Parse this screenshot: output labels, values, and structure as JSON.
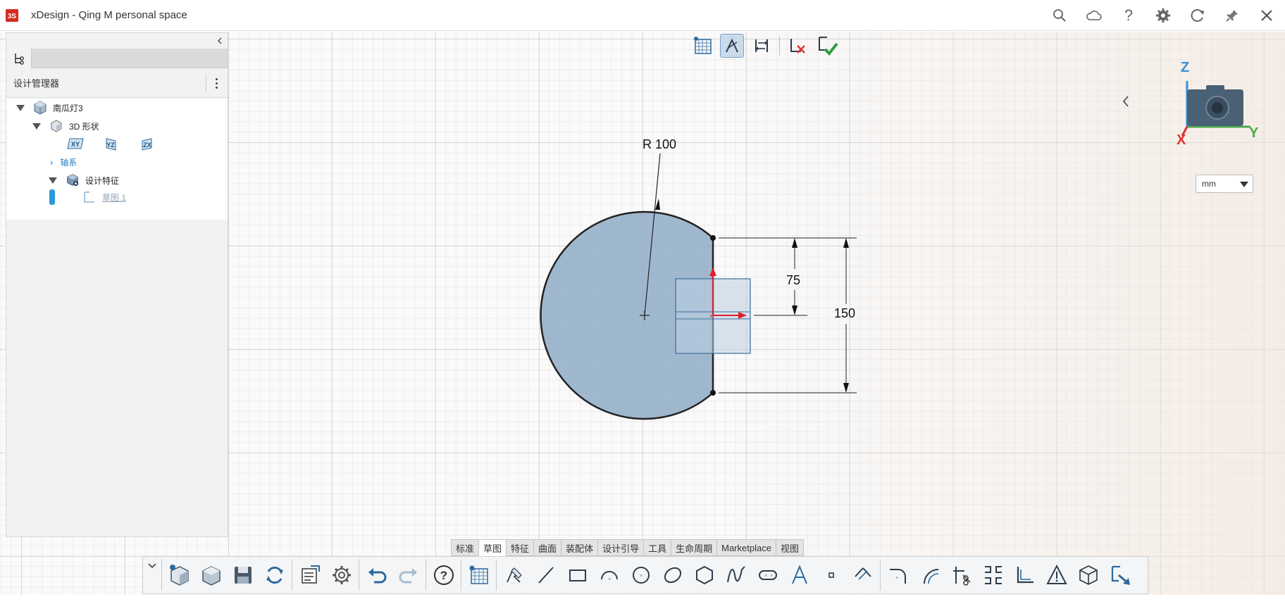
{
  "window": {
    "title": "xDesign - Qing M personal space",
    "logo": "3ds-logo-icon"
  },
  "titlebar_icons": [
    "search-icon",
    "cloud-icon",
    "help-icon",
    "settings-icon",
    "refresh-icon",
    "pin-icon",
    "close-icon"
  ],
  "panel": {
    "header": "设计管理器",
    "tree": {
      "root": "南瓜灯3",
      "shapes": "3D 形状",
      "planes": [
        "XY",
        "YZ",
        "ZX"
      ],
      "axes": "轴系",
      "features": "设计特征",
      "sketch": "草图.1"
    }
  },
  "sketch": {
    "radius_label": "R 100",
    "dim_small": "75",
    "dim_large": "150"
  },
  "view": {
    "axes": {
      "x": "X",
      "y": "Y",
      "z": "Z"
    },
    "unit": "mm"
  },
  "bottom_tabs": [
    "标准",
    "草图",
    "特征",
    "曲面",
    "装配体",
    "设计引导",
    "工具",
    "生命周期",
    "Marketplace",
    "视图"
  ],
  "active_tab": "草图",
  "colors": {
    "accent": "#1f7fc4",
    "sketch_fill": "#8aa7c3",
    "constraint_red": "#e0202a",
    "x_axis": "#e03030",
    "y_axis": "#49a84c",
    "z_axis": "#3a8fd6"
  }
}
